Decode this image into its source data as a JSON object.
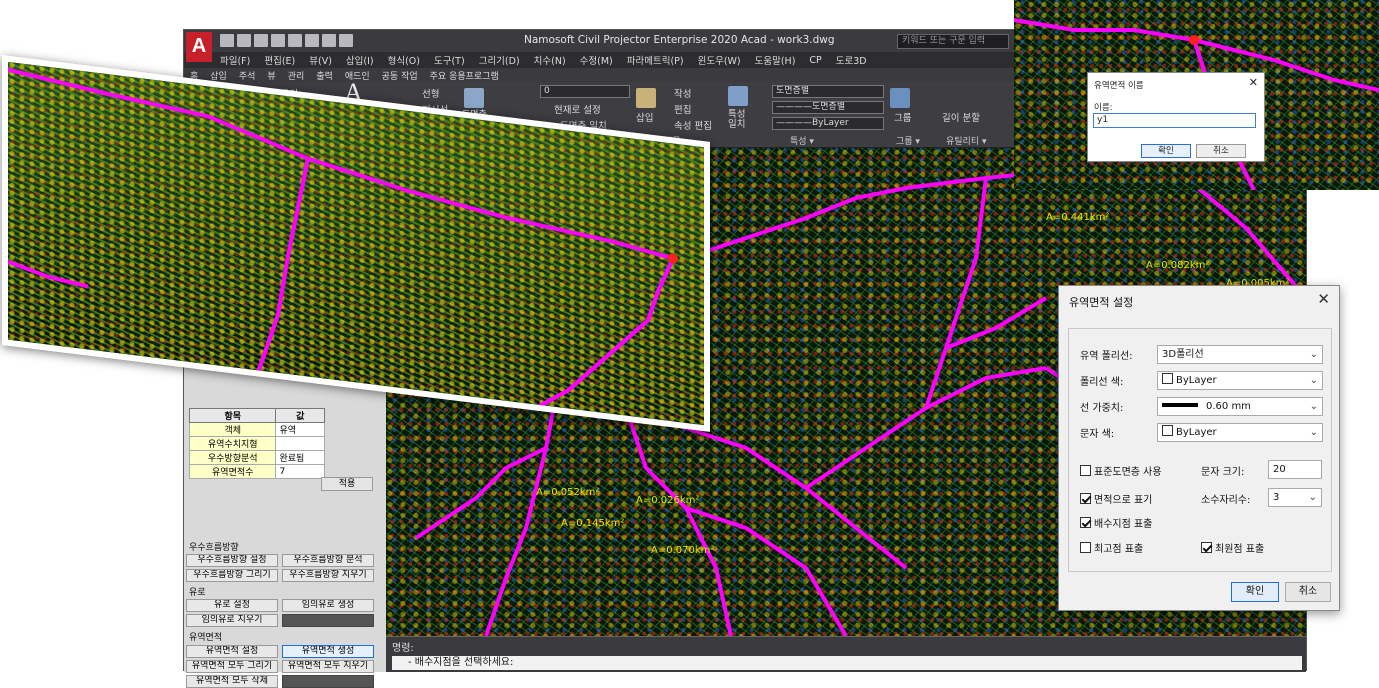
{
  "app": {
    "logo": "A",
    "title": "Namosoft Civil Projector Enterprise 2020   Acad - work3.dwg",
    "search_placeholder": "키워드 또는 구문 입력"
  },
  "menu": [
    "파일(F)",
    "편집(E)",
    "뷰(V)",
    "삽입(I)",
    "형식(O)",
    "도구(T)",
    "그리기(D)",
    "치수(N)",
    "수정(M)",
    "파라메트릭(P)",
    "윈도우(W)",
    "도움말(H)",
    "CP",
    "도로3D"
  ],
  "ribbon_tabs": [
    "홈",
    "삽입",
    "주석",
    "뷰",
    "관리",
    "출력",
    "애드인",
    "공동 작업",
    "주요 응용프로그램"
  ],
  "ribbon": {
    "cut": "자르기",
    "line": "선형",
    "leader": "지시선",
    "layer_props": "도면층 특성",
    "layer_value": "0",
    "current_set": "현재로 설정",
    "layer_match": "도면층 일치",
    "insert": "삽입",
    "create": "작성",
    "edit": "편집",
    "attr_edit": "속성 편집",
    "block_group": "블록 ▾",
    "match_props": "특성 일치",
    "layer_color": "도면층별",
    "layer_linetype": "————도면층별",
    "bylayer": "————ByLayer",
    "props_group": "특성 ▾",
    "group": "그룹",
    "group_group": "그룹 ▾",
    "measure": "길이 분할",
    "utility_group": "유틸리티 ▾"
  },
  "properties_table": {
    "headers": [
      "항목",
      "값"
    ],
    "rows": [
      [
        "객체",
        "유역"
      ],
      [
        "유역수치지형",
        ""
      ],
      [
        "우수방향분석",
        "완료됨"
      ],
      [
        "유역면적수",
        "7"
      ]
    ]
  },
  "apply_label": "적용",
  "palette": {
    "sections": [
      {
        "label": "우수흐름방향",
        "buttons": [
          "우수흐름방향 설정",
          "우수흐름방향 분석",
          "우수흐름방향 그리기",
          "우수흐름방향 지우기"
        ]
      },
      {
        "label": "유로",
        "buttons": [
          "유로 설정",
          "임의유로 생성",
          "임의유로 지우기"
        ]
      },
      {
        "label": "유역면적",
        "buttons": [
          "유역면적 설정",
          "유역면적 생성",
          "유역면적 모두 그리기",
          "유역면적 모두 지우기",
          "유역면적 모두 삭제"
        ]
      }
    ]
  },
  "command": {
    "label": "명령:",
    "prompt": "- 배수지점을 선택하세요:"
  },
  "area_labels": [
    "A=0.052km²",
    "A=0.145km²",
    "A=0.026km²",
    "A=0.070km²",
    "A=0.441km²",
    "A=0.082km²",
    "A=0.005km²"
  ],
  "name_dialog": {
    "title": "유역면적 이름",
    "label": "이름:",
    "value": "y1",
    "ok": "확인",
    "cancel": "취소"
  },
  "settings_dialog": {
    "title": "유역면적 설정",
    "fields": [
      {
        "label": "유역 폴리선:",
        "value": "3D폴리선"
      },
      {
        "label": "폴리선 색:",
        "value": "ByLayer"
      },
      {
        "label": "선 가중치:",
        "value": "0.60 mm"
      },
      {
        "label": "문자 색:",
        "value": "ByLayer"
      }
    ],
    "use_std_layer": {
      "label": "표준도면층 사용",
      "checked": false
    },
    "text_size_label": "문자 크기:",
    "text_size": "20",
    "show_area": {
      "label": "면적으로 표기",
      "checked": true
    },
    "decimals_label": "소수자리수:",
    "decimals": "3",
    "show_drain": {
      "label": "배수지점 표출",
      "checked": true
    },
    "show_high": {
      "label": "최고점 표출",
      "checked": false
    },
    "show_low": {
      "label": "최원점 표출",
      "checked": true
    },
    "ok": "확인",
    "cancel": "취소"
  },
  "colors": {
    "watershed": "#ff00ff",
    "accent": "#1f6fd0",
    "cad_bg": "#2d2d30"
  }
}
